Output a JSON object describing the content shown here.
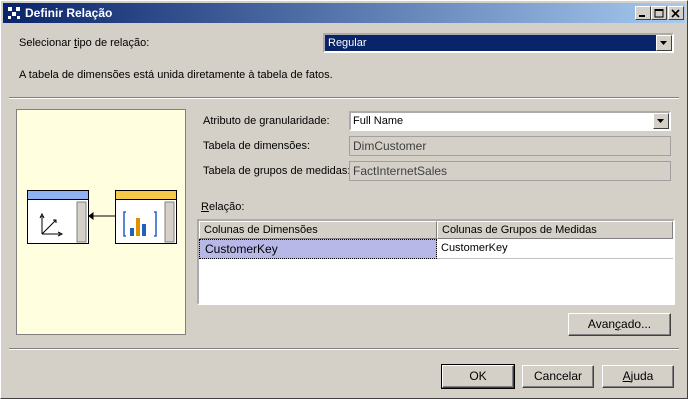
{
  "window": {
    "title": "Definir Relação"
  },
  "relationship_type": {
    "label_pre": "Selecionar ",
    "label_u": "t",
    "label_post": "ipo de relação:",
    "value": "Regular"
  },
  "description": "A tabela de dimensões está unida diretamente à tabela de fatos.",
  "granularity": {
    "label": "Atributo de granularidade:",
    "value": "Full Name"
  },
  "dimension_table": {
    "label": "Tabela de dimensões:",
    "value": "DimCustomer"
  },
  "measure_group_table": {
    "label": "Tabela de grupos de medidas:",
    "value": "FactInternetSales"
  },
  "relation": {
    "label_u": "R",
    "label_post": "elação:",
    "columns": [
      "Colunas de Dimensões",
      "Colunas de Grupos de Medidas"
    ],
    "rows": [
      {
        "dimension": "CustomerKey",
        "measure": "CustomerKey"
      }
    ]
  },
  "buttons": {
    "advanced_pre": "Avan",
    "advanced_u": "ç",
    "advanced_post": "ado...",
    "ok": "OK",
    "cancel": "Cancelar",
    "help_u": "A",
    "help_post": "juda"
  },
  "colors": {
    "preview_bg": "#ffffe0",
    "dim_header": "#8fb3f0",
    "fact_header": "#f7c948",
    "selected_cell": "#b8b8e8"
  }
}
